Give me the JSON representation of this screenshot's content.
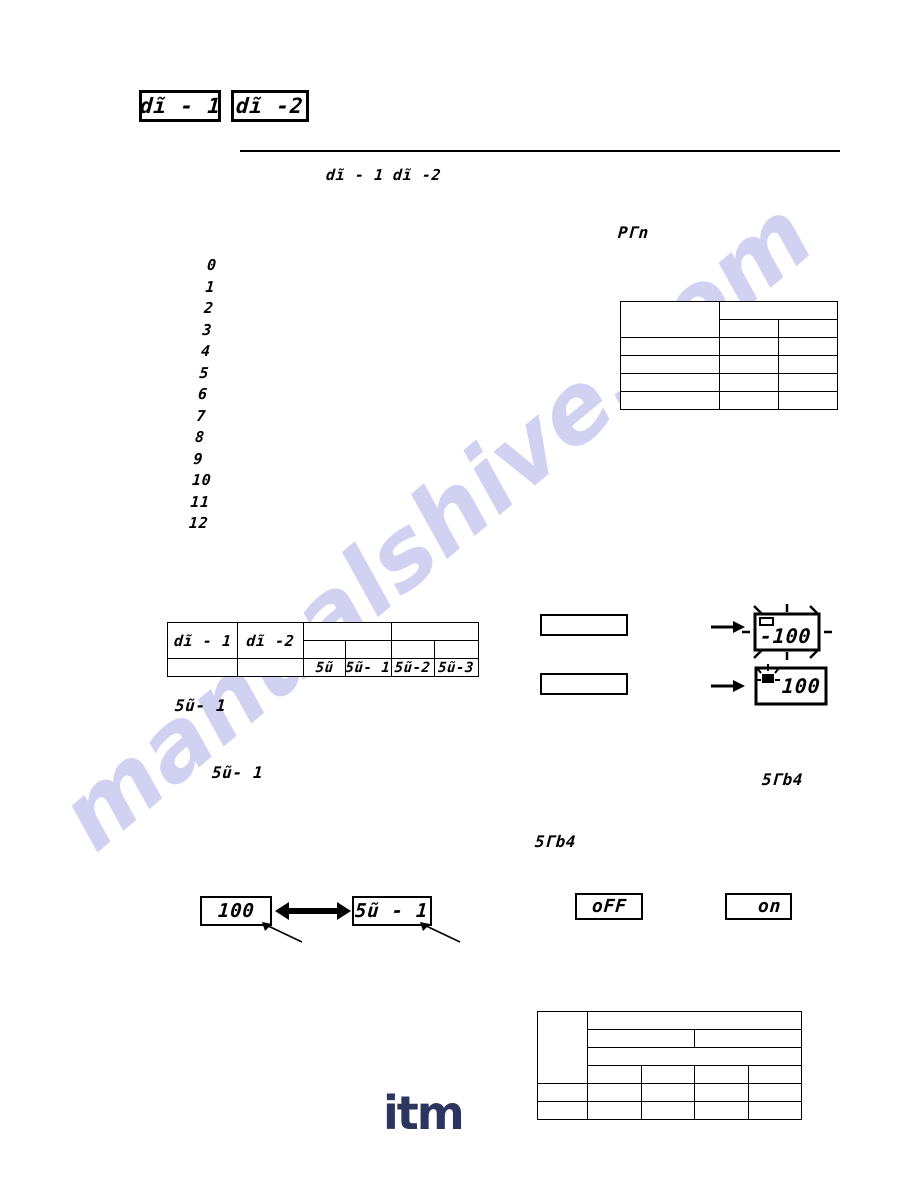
{
  "document": {
    "type": "instrument-manual-page",
    "watermark_primary": "manualshive.com",
    "logo_text": "itm"
  },
  "header": {
    "box_1_label": "dĩ - 1",
    "box_2_label": "dĩ -2",
    "subheading_param_1": "dĩ - 1",
    "subheading_param_2": "dĩ -2"
  },
  "right_column": {
    "prn_label": "PΓn"
  },
  "option_list": {
    "values": [
      "0",
      "1",
      "2",
      "3",
      "4",
      "5",
      "6",
      "7",
      "8",
      "9",
      "10",
      "11",
      "12"
    ]
  },
  "prn_table": {
    "rows": 5,
    "cells": [
      [
        "",
        "",
        ""
      ],
      [
        "",
        "",
        ""
      ],
      [
        "",
        "",
        ""
      ],
      [
        "",
        "",
        ""
      ],
      [
        "",
        "",
        ""
      ],
      [
        "",
        "",
        ""
      ]
    ]
  },
  "su_table": {
    "header_left": [
      "dĩ - 1",
      "dĩ -2"
    ],
    "body_left": [
      "",
      ""
    ],
    "sub_labels": [
      "5ũ",
      "5ũ- 1",
      "5ũ-2",
      "5ũ-3"
    ]
  },
  "su_captions": {
    "caption_1": "5ũ- 1",
    "caption_2": "5ũ- 1"
  },
  "toggle_diagram": {
    "left_display": "100",
    "right_display": "5ũ - 1",
    "arrow": "double-arrow"
  },
  "flash_blocks": {
    "empty_box_1": "",
    "empty_box_2": "",
    "display_1": "-100",
    "display_2": "100",
    "arrow": "right-arrow"
  },
  "standby": {
    "label_right": "5Γb4",
    "label_left": "5Γb4",
    "off_display": "oFF",
    "on_display": "on"
  },
  "bottom_table": {
    "rows": 6,
    "cells": [
      [
        "",
        "",
        "",
        "",
        ""
      ],
      [
        "",
        "",
        "",
        "",
        ""
      ],
      [
        "",
        "",
        "",
        "",
        ""
      ],
      [
        "",
        "",
        "",
        "",
        ""
      ],
      [
        "",
        "",
        "",
        "",
        ""
      ],
      [
        "",
        "",
        "",
        "",
        ""
      ]
    ]
  },
  "colors": {
    "ink": "#000000",
    "watermark": "#c9cbf0",
    "logo": "#2b3560"
  }
}
